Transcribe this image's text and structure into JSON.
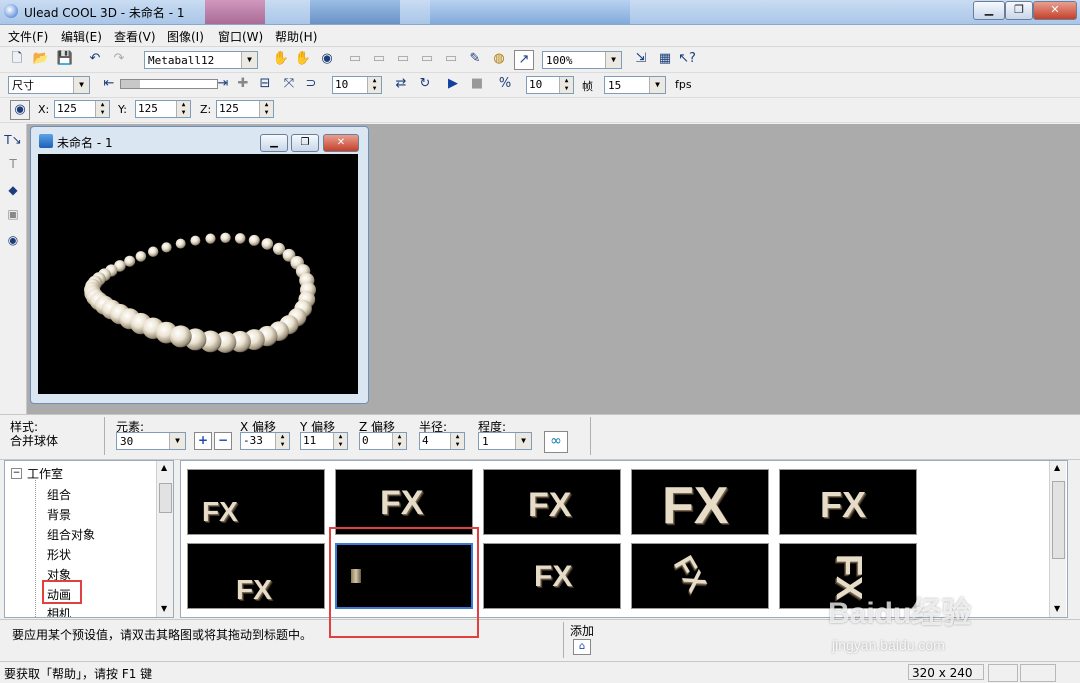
{
  "window": {
    "title": "Ulead COOL 3D - 未命名 - 1"
  },
  "menu": [
    "文件(F)",
    "编辑(E)",
    "查看(V)",
    "图像(I)",
    "窗口(W)",
    "帮助(H)"
  ],
  "toolbar1": {
    "object_combo": "Metaball12",
    "zoom_combo": "100%"
  },
  "toolbar2": {
    "mode_combo": "尺寸",
    "value_a": "10",
    "value_b": "10",
    "frames_label": "帧",
    "frames_value": "15",
    "fps_label": "fps"
  },
  "toolbar3": {
    "x_label": "X:",
    "x_value": "125",
    "y_label": "Y:",
    "y_value": "125",
    "z_label": "Z:",
    "z_value": "125"
  },
  "document": {
    "title": "未命名 - 1"
  },
  "properties": {
    "style_label": "样式:",
    "style_value": "合并球体",
    "elements_label": "元素:",
    "elements_value": "30",
    "x_offset_label": "X 偏移",
    "x_offset_value": "-33",
    "y_offset_label": "Y 偏移",
    "y_offset_value": "11",
    "z_offset_label": "Z 偏移",
    "z_offset_value": "0",
    "radius_label": "半径:",
    "radius_value": "4",
    "degree_label": "程度:",
    "degree_value": "1"
  },
  "tree": {
    "root": "工作室",
    "items": [
      "组合",
      "背景",
      "组合对象",
      "形状",
      "对象",
      "动画",
      "相机"
    ]
  },
  "thumbs": {
    "text": "FX"
  },
  "hint": {
    "text": "要应用某个预设值，请双击其略图或将其拖动到标题中。",
    "add_label": "添加"
  },
  "status": {
    "help_text": "要获取「帮助」，请按 F1 键",
    "size": "320 x 240"
  },
  "watermark": {
    "brand": "Baidu经验",
    "url": "jingyan.baidu.com"
  },
  "colors": {
    "highlight": "#e04040",
    "canvas": "#000000",
    "workspace": "#ababab"
  }
}
